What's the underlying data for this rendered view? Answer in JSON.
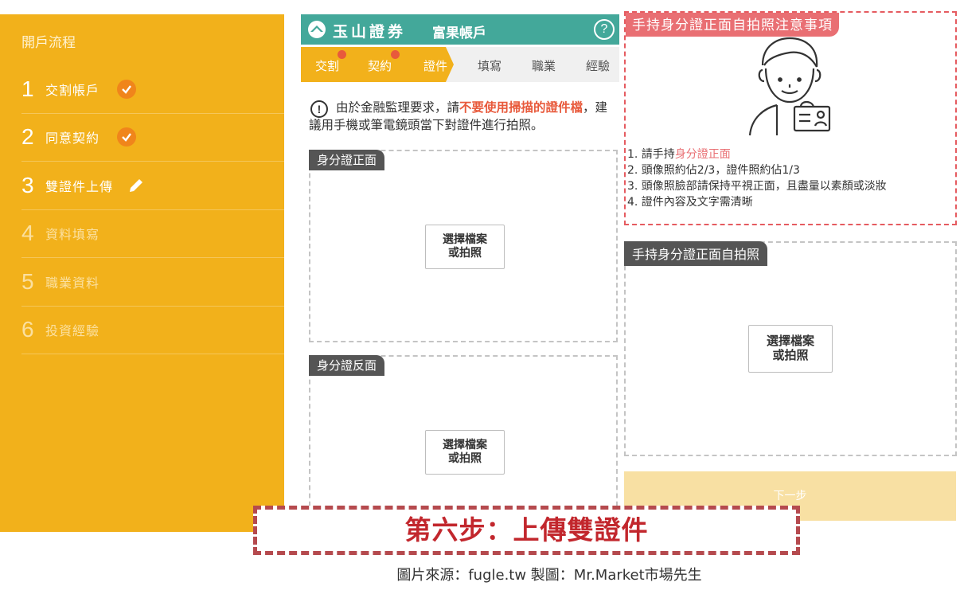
{
  "sidebar": {
    "title": "開戶流程",
    "items": [
      {
        "num": "1",
        "label": "交割帳戶"
      },
      {
        "num": "2",
        "label": "同意契約"
      },
      {
        "num": "3",
        "label": "雙證件上傳"
      },
      {
        "num": "4",
        "label": "資料填寫"
      },
      {
        "num": "5",
        "label": "職業資料"
      },
      {
        "num": "6",
        "label": "投資經驗"
      }
    ]
  },
  "header": {
    "brand": "玉山證券",
    "account": "富果帳戶",
    "help": "?"
  },
  "steps": [
    "交割",
    "契約",
    "證件",
    "填寫",
    "職業",
    "經驗"
  ],
  "notice": {
    "icon": "!",
    "pre": "由於金融監理要求，請",
    "highlight": "不要使用掃描的證件檔",
    "post": "，建議用手機或筆電鏡頭當下對證件進行拍照。"
  },
  "uploads": {
    "front_label": "身分證正面",
    "back_label": "身分證反面",
    "selfie_label": "手持身分證正面自拍照",
    "button_line1": "選擇檔案",
    "button_line2": "或拍照"
  },
  "notes": {
    "title": "手持身分證正面自拍照注意事項",
    "item1_pre": "1.  請手持",
    "item1_hl": "身分證正面",
    "item2": "2.  頭像照約佔2/3，證件照約佔1/3",
    "item3": "3.  頭像照臉部請保持平視正面，且盡量以素顏或淡妝",
    "item4": "4.  證件內容及文字需清晰"
  },
  "next_button": "下一步",
  "caption": "第六步：上傳雙證件",
  "credit": "圖片來源：fugle.tw  製圖：Mr.Market市場先生",
  "colors": {
    "sidebar": "#f2b11b",
    "header": "#43a89a",
    "accent_red": "#e96f73",
    "caption_red": "#c2272d",
    "check_orange": "#f0851b"
  }
}
